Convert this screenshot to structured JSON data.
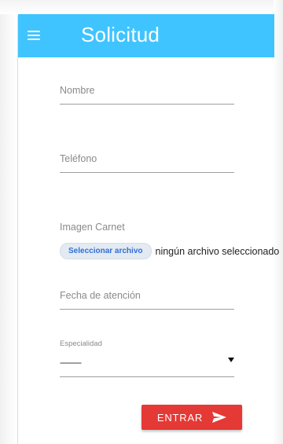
{
  "appbar": {
    "title": "Solicitud",
    "menu_icon": "hamburger-menu-icon",
    "color": "#40c4ff"
  },
  "form": {
    "nombre": {
      "label": "Nombre",
      "value": ""
    },
    "telefono": {
      "label": "Teléfono",
      "value": ""
    },
    "imagen_carnet": {
      "label": "Imagen Carnet",
      "button_label": "Seleccionar archivo",
      "status_text": "ningún archivo seleccionado"
    },
    "fecha_atencion": {
      "label": "Fecha de atención",
      "value": ""
    },
    "especialidad": {
      "label": "Especialidad",
      "selected_value": "---------"
    },
    "submit": {
      "label": "ENTRAR",
      "icon": "send-icon",
      "color": "#e53935"
    }
  }
}
